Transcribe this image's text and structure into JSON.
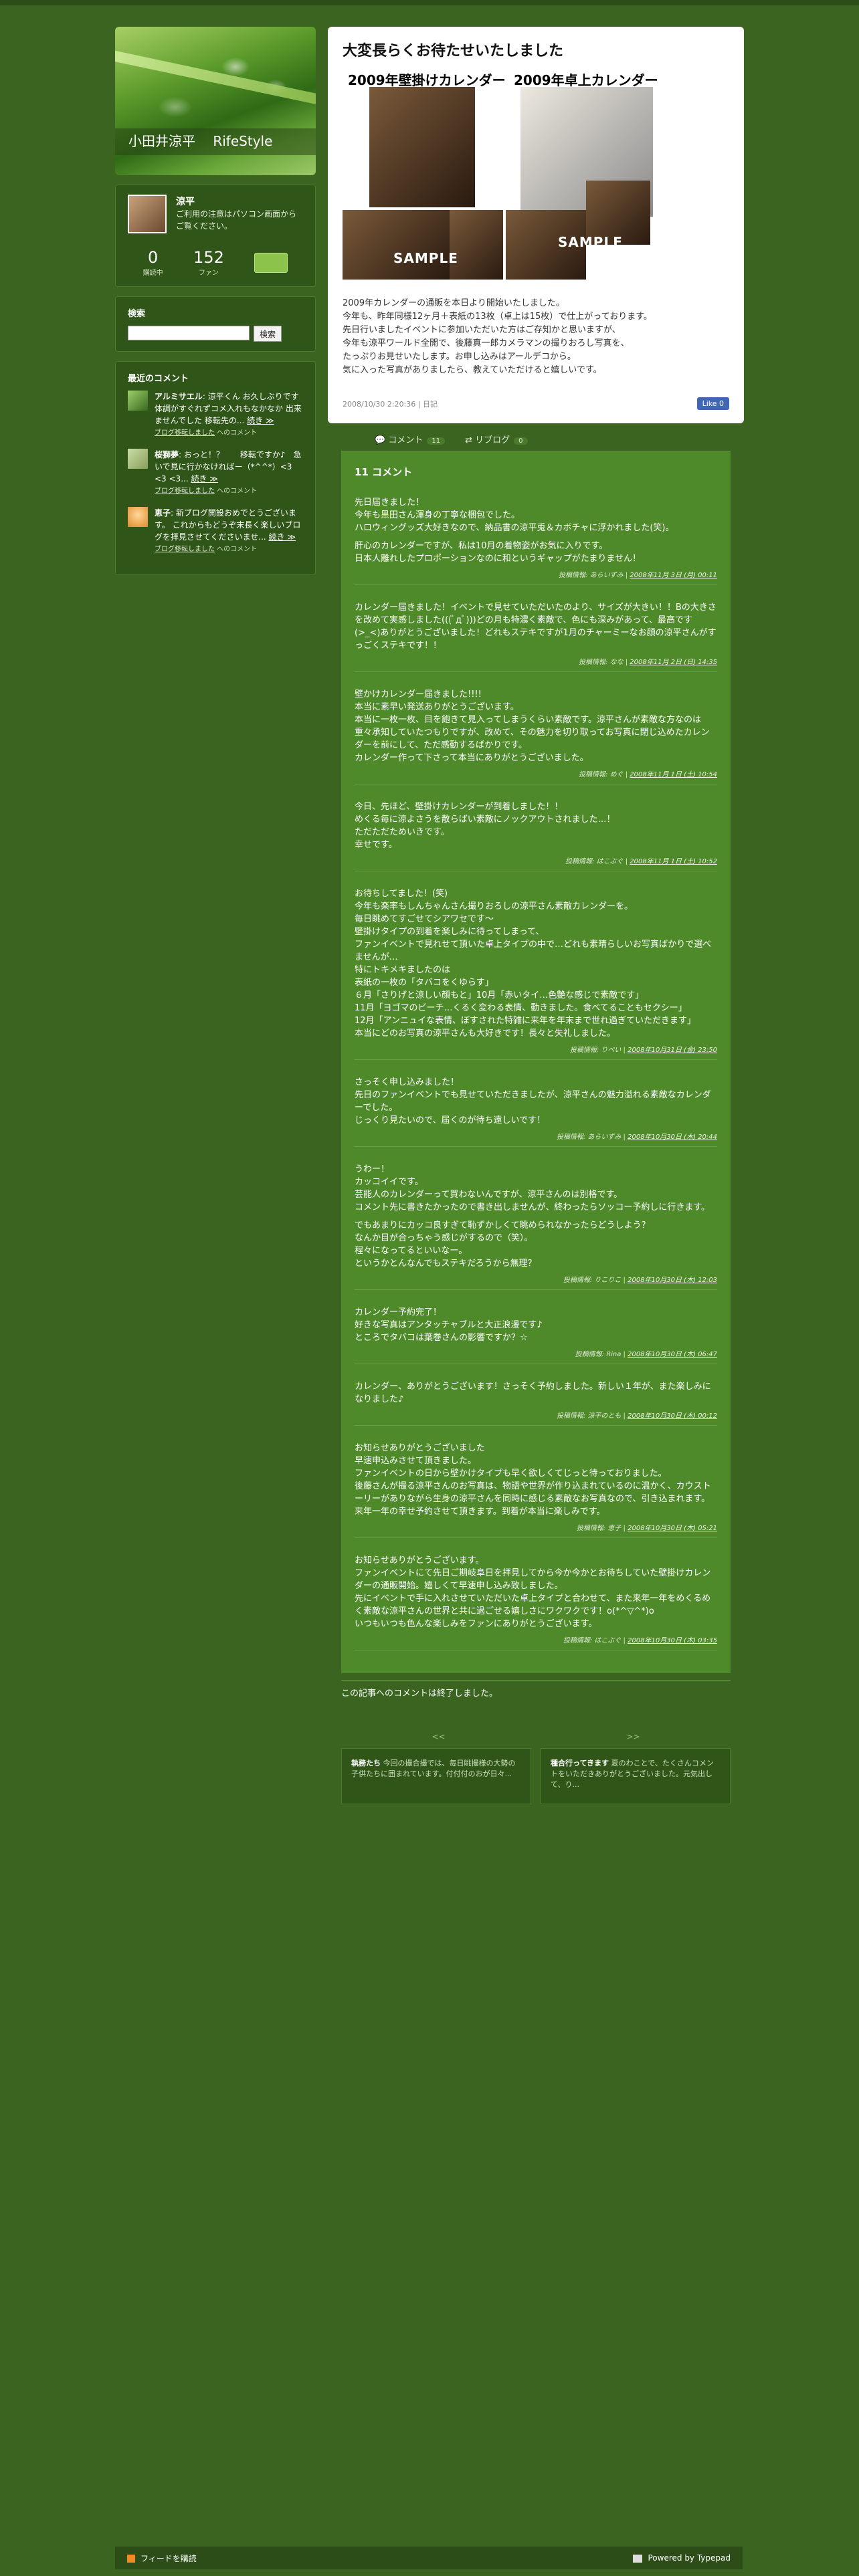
{
  "site": {
    "title": "小田井涼平 　RifeStyle"
  },
  "profile": {
    "name": "涼平",
    "note": "ご利用の注意はパソコン画面からご覧ください。",
    "stats": [
      {
        "num": "0",
        "label": "購読中"
      },
      {
        "num": "152",
        "label": "ファン"
      }
    ]
  },
  "search": {
    "title": "検索",
    "button": "検索"
  },
  "recent": {
    "title": "最近のコメント",
    "items": [
      {
        "author": "アルミサエル",
        "text": ": 涼平くん お久しぶりです体調がすぐれずコメ入れもなかなか 出来ませんでした 移転先の...",
        "more": "続き ≫",
        "meta_link": "ブログ移転しました",
        "meta_suffix": " へのコメント"
      },
      {
        "author": "桜獅夢",
        "text": ": おっと！？　　移転ですか♪　急いで見に行かなければー（*^^*）<3 <3 <3...",
        "more": "続き ≫",
        "meta_link": "ブログ移転しました",
        "meta_suffix": " へのコメント"
      },
      {
        "author": "恵子",
        "text": ": 新ブログ開設おめでとうございます。 これからもどうぞ末長く楽しいブログを拝見させてくださいませ...",
        "more": "続き ≫",
        "meta_link": "ブログ移転しました",
        "meta_suffix": " へのコメント"
      }
    ]
  },
  "article": {
    "title": "大変長らくお待たせいたしました",
    "cal1_label": "2009年壁掛けカレンダー",
    "cal2_label": "2009年卓上カレンダー",
    "sample_label": "SAMPLE",
    "body": [
      "2009年カレンダーの通販を本日より開始いたしました。",
      "今年も、昨年同様12ヶ月＋表紙の13枚（卓上は15枚）で仕上がっております。",
      "先日行いましたイベントに参加いただいた方はご存知かと思いますが、",
      "今年も涼平ワールド全開で、後藤真一郎カメラマンの撮りおろし写真を、",
      "たっぷりお見せいたします。お申し込みはアールデコから。",
      "気に入った写真がありましたら、教えていただけると嬉しいです。"
    ],
    "meta": "2008/10/30 2:20:36 | 日記",
    "like": "Like 0"
  },
  "tabs": [
    {
      "label": "コメント",
      "count": "11"
    },
    {
      "label": "リブログ",
      "count": "0"
    }
  ],
  "comments": {
    "title": "11 コメント",
    "items": [
      {
        "paras": [
          [
            "先日届きました！",
            "今年も黒田さん渾身の丁寧な梱包でした。",
            "ハロウィングッズ大好きなので、納品書の涼平兎＆カボチャに浮かれました(笑)。"
          ],
          [
            "肝心のカレンダーですが、私は10月の着物姿がお気に入りです。",
            "日本人離れしたプロポーションなのに和というギャップがたまりません！"
          ]
        ],
        "meta_prefix": "投稿情報: あらいずみ | ",
        "meta_link": "2008年11月 3日 (月) 00:11"
      },
      {
        "paras": [
          [
            "カレンダー届きました！イベントで見せていただいたのより、サイズが大きい！！Bの大きさを改めて実感しました(((ﾟдﾟ)))どの月も特濃く素敵で、色にも深みがあって、最高です(>_<)ありがとうございました！どれもステキですが1月のチャーミーなお顔の涼平さんがすっごくステキです！！"
          ]
        ],
        "meta_prefix": "投稿情報: なな | ",
        "meta_link": "2008年11月 2日 (日) 14:35"
      },
      {
        "paras": [
          [
            "壁かけカレンダー届きました!!!!",
            "本当に素早い発送ありがとうございます。",
            "本当に一枚一枚、目を飽きて見入ってしまうくらい素敵です。涼平さんが素敵な方なのは重々承知していたつもりですが、改めて、その魅力を切り取ってお写真に閉じ込めたカレンダーを前にして、ただ感動するばかりです。",
            "カレンダー作って下さって本当にありがとうございました。"
          ]
        ],
        "meta_prefix": "投稿情報: めぐ | ",
        "meta_link": "2008年11月 1日 (土) 10:54"
      },
      {
        "paras": [
          [
            "今日、先ほど、壁掛けカレンダーが到着しました！！",
            "めくる毎に涼よさうを散らばい素敵にノックアウトされました…！",
            "ただただためいきです。",
            "幸せです。"
          ]
        ],
        "meta_prefix": "投稿情報: はこぶぐ | ",
        "meta_link": "2008年11月 1日 (土) 10:52"
      },
      {
        "paras": [
          [
            "お待ちしてました！(笑)",
            "今年も楽率もしんちゃんさん撮りおろしの涼平さん素敵カレンダーを。",
            "毎日眺めてすごせてシアワセです〜",
            "壁掛けタイプの到着を楽しみに待ってしまって、",
            "ファンイベントで見れせて頂いた卓上タイプの中で…どれも素晴らしいお写真ばかりで選べませんが…",
            "特にトキメキましたのは",
            "表紙の一枚の「タバコをくゆらす」",
            "６月「さりげと涼しい顔もと」10月「赤いタイ…色艶な感じで素敵です」",
            "11月「ヨゴマのビーチ…くるく変わる表情、動きました。食べてることもセクシー」",
            "12月「アンニュイな表情、ぼすされた特雑に来年を年末まで世れ過ぎていただきます」",
            "本当にどのお写真の涼平さんも大好きです！長々と失礼しました。"
          ]
        ],
        "meta_prefix": "投稿情報: りぺい | ",
        "meta_link": "2008年10月31日 (金) 23:50"
      },
      {
        "paras": [
          [
            "さっそく申し込みました！",
            "先日のファンイベントでも見せていただきましたが、涼平さんの魅力溢れる素敵なカレンダーでした。",
            "じっくり見たいので、届くのが待ち遠しいです！"
          ]
        ],
        "meta_prefix": "投稿情報: あらいずみ | ",
        "meta_link": "2008年10月30日 (木) 20:44"
      },
      {
        "paras": [
          [
            "うわー！",
            "カッコイイです。",
            "芸能人のカレンダーって買わないんですが、涼平さんのは別格です。",
            "コメント先に書きたかったので書き出しませんが、終わったらソッコー予約しに行きます。"
          ],
          [
            "でもあまりにカッコ良すぎて恥ずかしくて眺められなかったらどうしよう？",
            "なんか目が合っちゃう感じがするので（笑）。",
            "程々になってるといいなー。",
            "というかとんなんでもステキだろうから無理？"
          ]
        ],
        "meta_prefix": "投稿情報: りこりこ | ",
        "meta_link": "2008年10月30日 (木) 12:03"
      },
      {
        "paras": [
          [
            "カレンダー予約完了！",
            "好きな写真はアンタッチャブルと大正浪漫です♪",
            "ところでタバコは葉巻さんの影響ですか？☆"
          ]
        ],
        "meta_prefix": "投稿情報: Rina | ",
        "meta_link": "2008年10月30日 (木) 06:47"
      },
      {
        "paras": [
          [
            "カレンダー、ありがとうございます！さっそく予約しました。新しい１年が、また楽しみになりました♪"
          ]
        ],
        "meta_prefix": "投稿情報: 涼平のとも | ",
        "meta_link": "2008年10月30日 (木) 00:12"
      },
      {
        "paras": [
          [
            "お知らせありがとうございました",
            "早速申込みさせて頂きました。",
            "ファンイベントの日から壁かけタイプも早く欲しくてじっと待っておりました。",
            "後藤さんが撮る涼平さんのお写真は、物語や世界が作り込まれているのに温かく、カウストーリーがありながら生身の涼平さんを同時に感じる素敵なお写真なので、引き込まれます。",
            "来年一年の幸せ予約させて頂きます。到着が本当に楽しみです。"
          ]
        ],
        "meta_prefix": "投稿情報: 恵子 | ",
        "meta_link": "2008年10月30日 (木) 05:21"
      },
      {
        "paras": [
          [
            "お知らせありがとうございます。",
            "ファンイベントにて先日ご期岐阜日を拝見してから今か今かとお待ちしていた壁掛けカレンダーの通販開始。嬉しくて早速申し込み致しました。",
            "先にイベントで手に入れさせていただいた卓上タイプと合わせて、また来年一年をめくるめく素敵な涼平さんの世界と共に過ごせる嬉しさにワクワクです！o(*^▽^*)o",
            "いつもいつも色んな楽しみをファンにありがとうございます。"
          ]
        ],
        "meta_prefix": "投稿情報: はこぶぐ | ",
        "meta_link": "2008年10月30日 (木) 03:35"
      }
    ],
    "closed": "この記事へのコメントは終了しました。"
  },
  "nav": {
    "prev": "<<",
    "next": ">>",
    "prev_title": "執務たち",
    "prev_text": " 今回の撮合撮では、毎日眺撮様の大勢の子供たちに囲まれています。付付付のおが日々...",
    "next_title": "種合行ってきます",
    "next_text": " 夏のわことで、たくさんコメントをいただきありがとうございました。元気出して、り..."
  },
  "footer": {
    "feed": "フィードを購読",
    "powered": "Powered by Typepad"
  }
}
